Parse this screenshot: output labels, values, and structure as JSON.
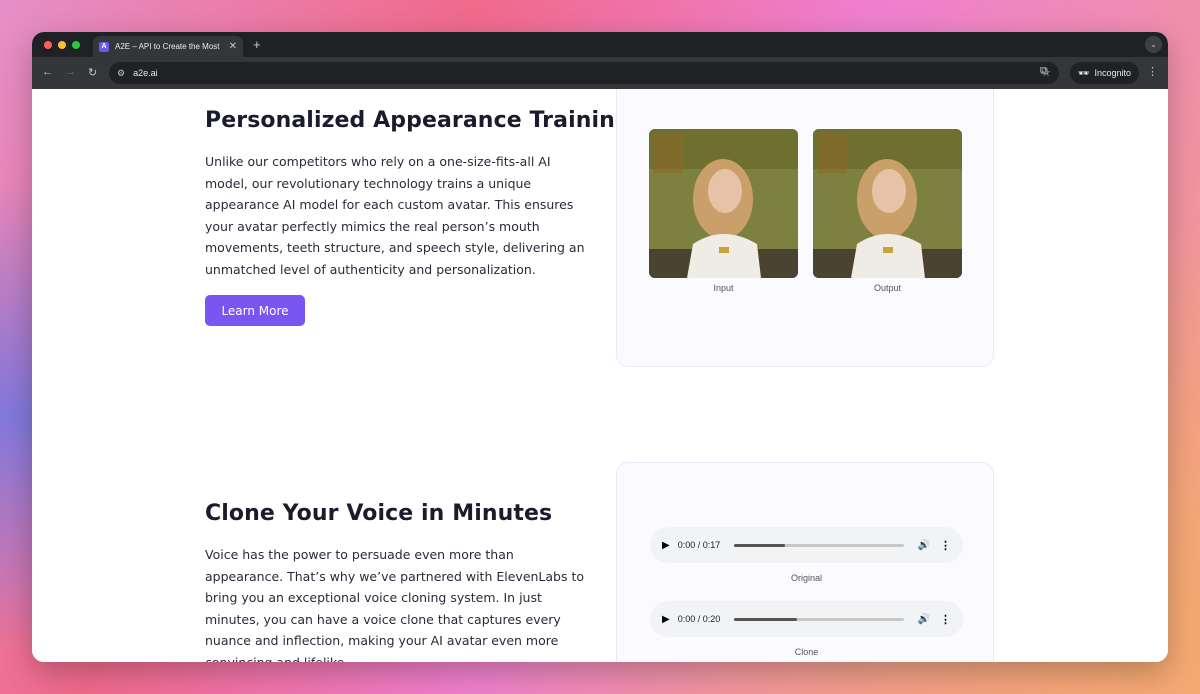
{
  "browser": {
    "tab_title": "A2E – API to Create the Most",
    "tab_favicon_letter": "A",
    "url": "a2e.ai",
    "incognito_label": "Incognito"
  },
  "section_appearance": {
    "title": "Personalized Appearance Training",
    "body": "Unlike our competitors who rely on a one-size-fits-all AI model, our revolutionary technology trains a unique appearance AI model for each custom avatar. This ensures your avatar perfectly mimics the real person’s mouth movements, teeth structure, and speech style, delivering an unmatched level of authenticity and personalization.",
    "button_label": "Learn More",
    "images": [
      {
        "caption": "Input"
      },
      {
        "caption": "Output"
      }
    ]
  },
  "section_voice": {
    "title": "Clone Your Voice in Minutes",
    "body": "Voice has the power to persuade even more than appearance. That’s why we’ve partnered with ElevenLabs to bring you an exceptional voice cloning system. In just minutes, you can have a voice clone that captures every nuance and inflection, making your AI avatar even more convincing and lifelike.",
    "players": [
      {
        "time": "0:00 / 0:17",
        "caption": "Original",
        "progress": 0.3
      },
      {
        "time": "0:00 / 0:20",
        "caption": "Clone",
        "progress": 0.37
      }
    ]
  },
  "colors": {
    "accent": "#7b55ef"
  }
}
